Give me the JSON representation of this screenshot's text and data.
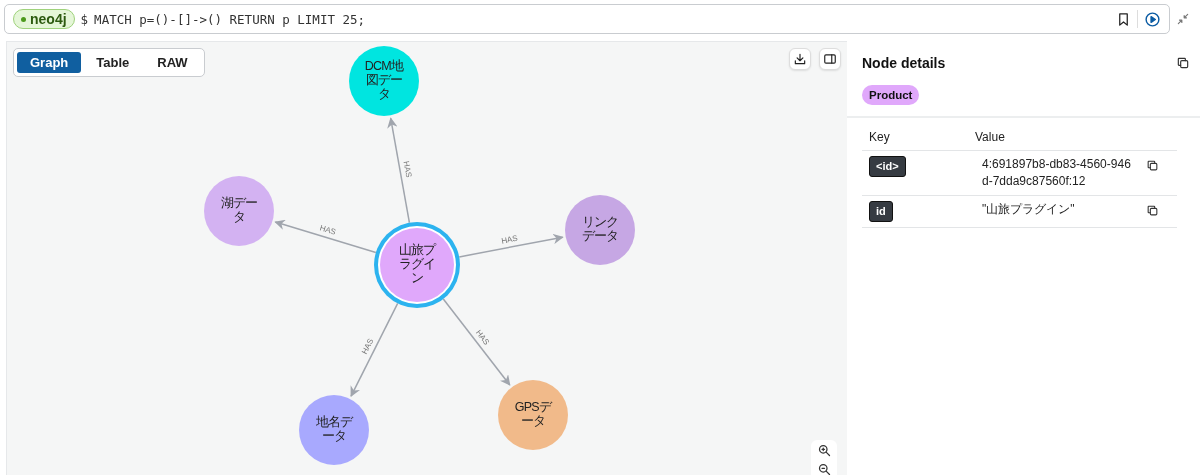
{
  "query_bar": {
    "db_badge": "neo4j",
    "prompt": "$",
    "query": "MATCH p=()-[]->() RETURN p LIMIT 25;"
  },
  "view_tabs": [
    {
      "label": "Graph",
      "selected": true
    },
    {
      "label": "Table",
      "selected": false
    },
    {
      "label": "RAW",
      "selected": false
    }
  ],
  "graph": {
    "nodes": [
      {
        "label": "DCM地図データ",
        "color": "#00e5e0",
        "selected": false
      },
      {
        "label": "湖データ",
        "color": "#d3b2f2",
        "selected": false
      },
      {
        "label": "山旅プラグイン",
        "color": "#e0a8fb",
        "selected": true
      },
      {
        "label": "リンクデータ",
        "color": "#c6a7e4",
        "selected": false
      },
      {
        "label": "地名データ",
        "color": "#a8a9fe",
        "selected": false
      },
      {
        "label": "GPSデータ",
        "color": "#f1ba8a",
        "selected": false
      }
    ],
    "relationships": [
      {
        "type": "HAS"
      },
      {
        "type": "HAS"
      },
      {
        "type": "HAS"
      },
      {
        "type": "HAS"
      },
      {
        "type": "HAS"
      }
    ]
  },
  "details": {
    "title": "Node details",
    "label_chip": {
      "text": "Product",
      "color": "#e0a8fb"
    },
    "columns": [
      "Key",
      "Value"
    ],
    "rows": [
      {
        "key": "<id>",
        "value": "4:691897b8-db83-4560-946d-7dda9c87560f:12"
      },
      {
        "key": "id",
        "value": "\"山旅プラグイン\""
      }
    ]
  }
}
